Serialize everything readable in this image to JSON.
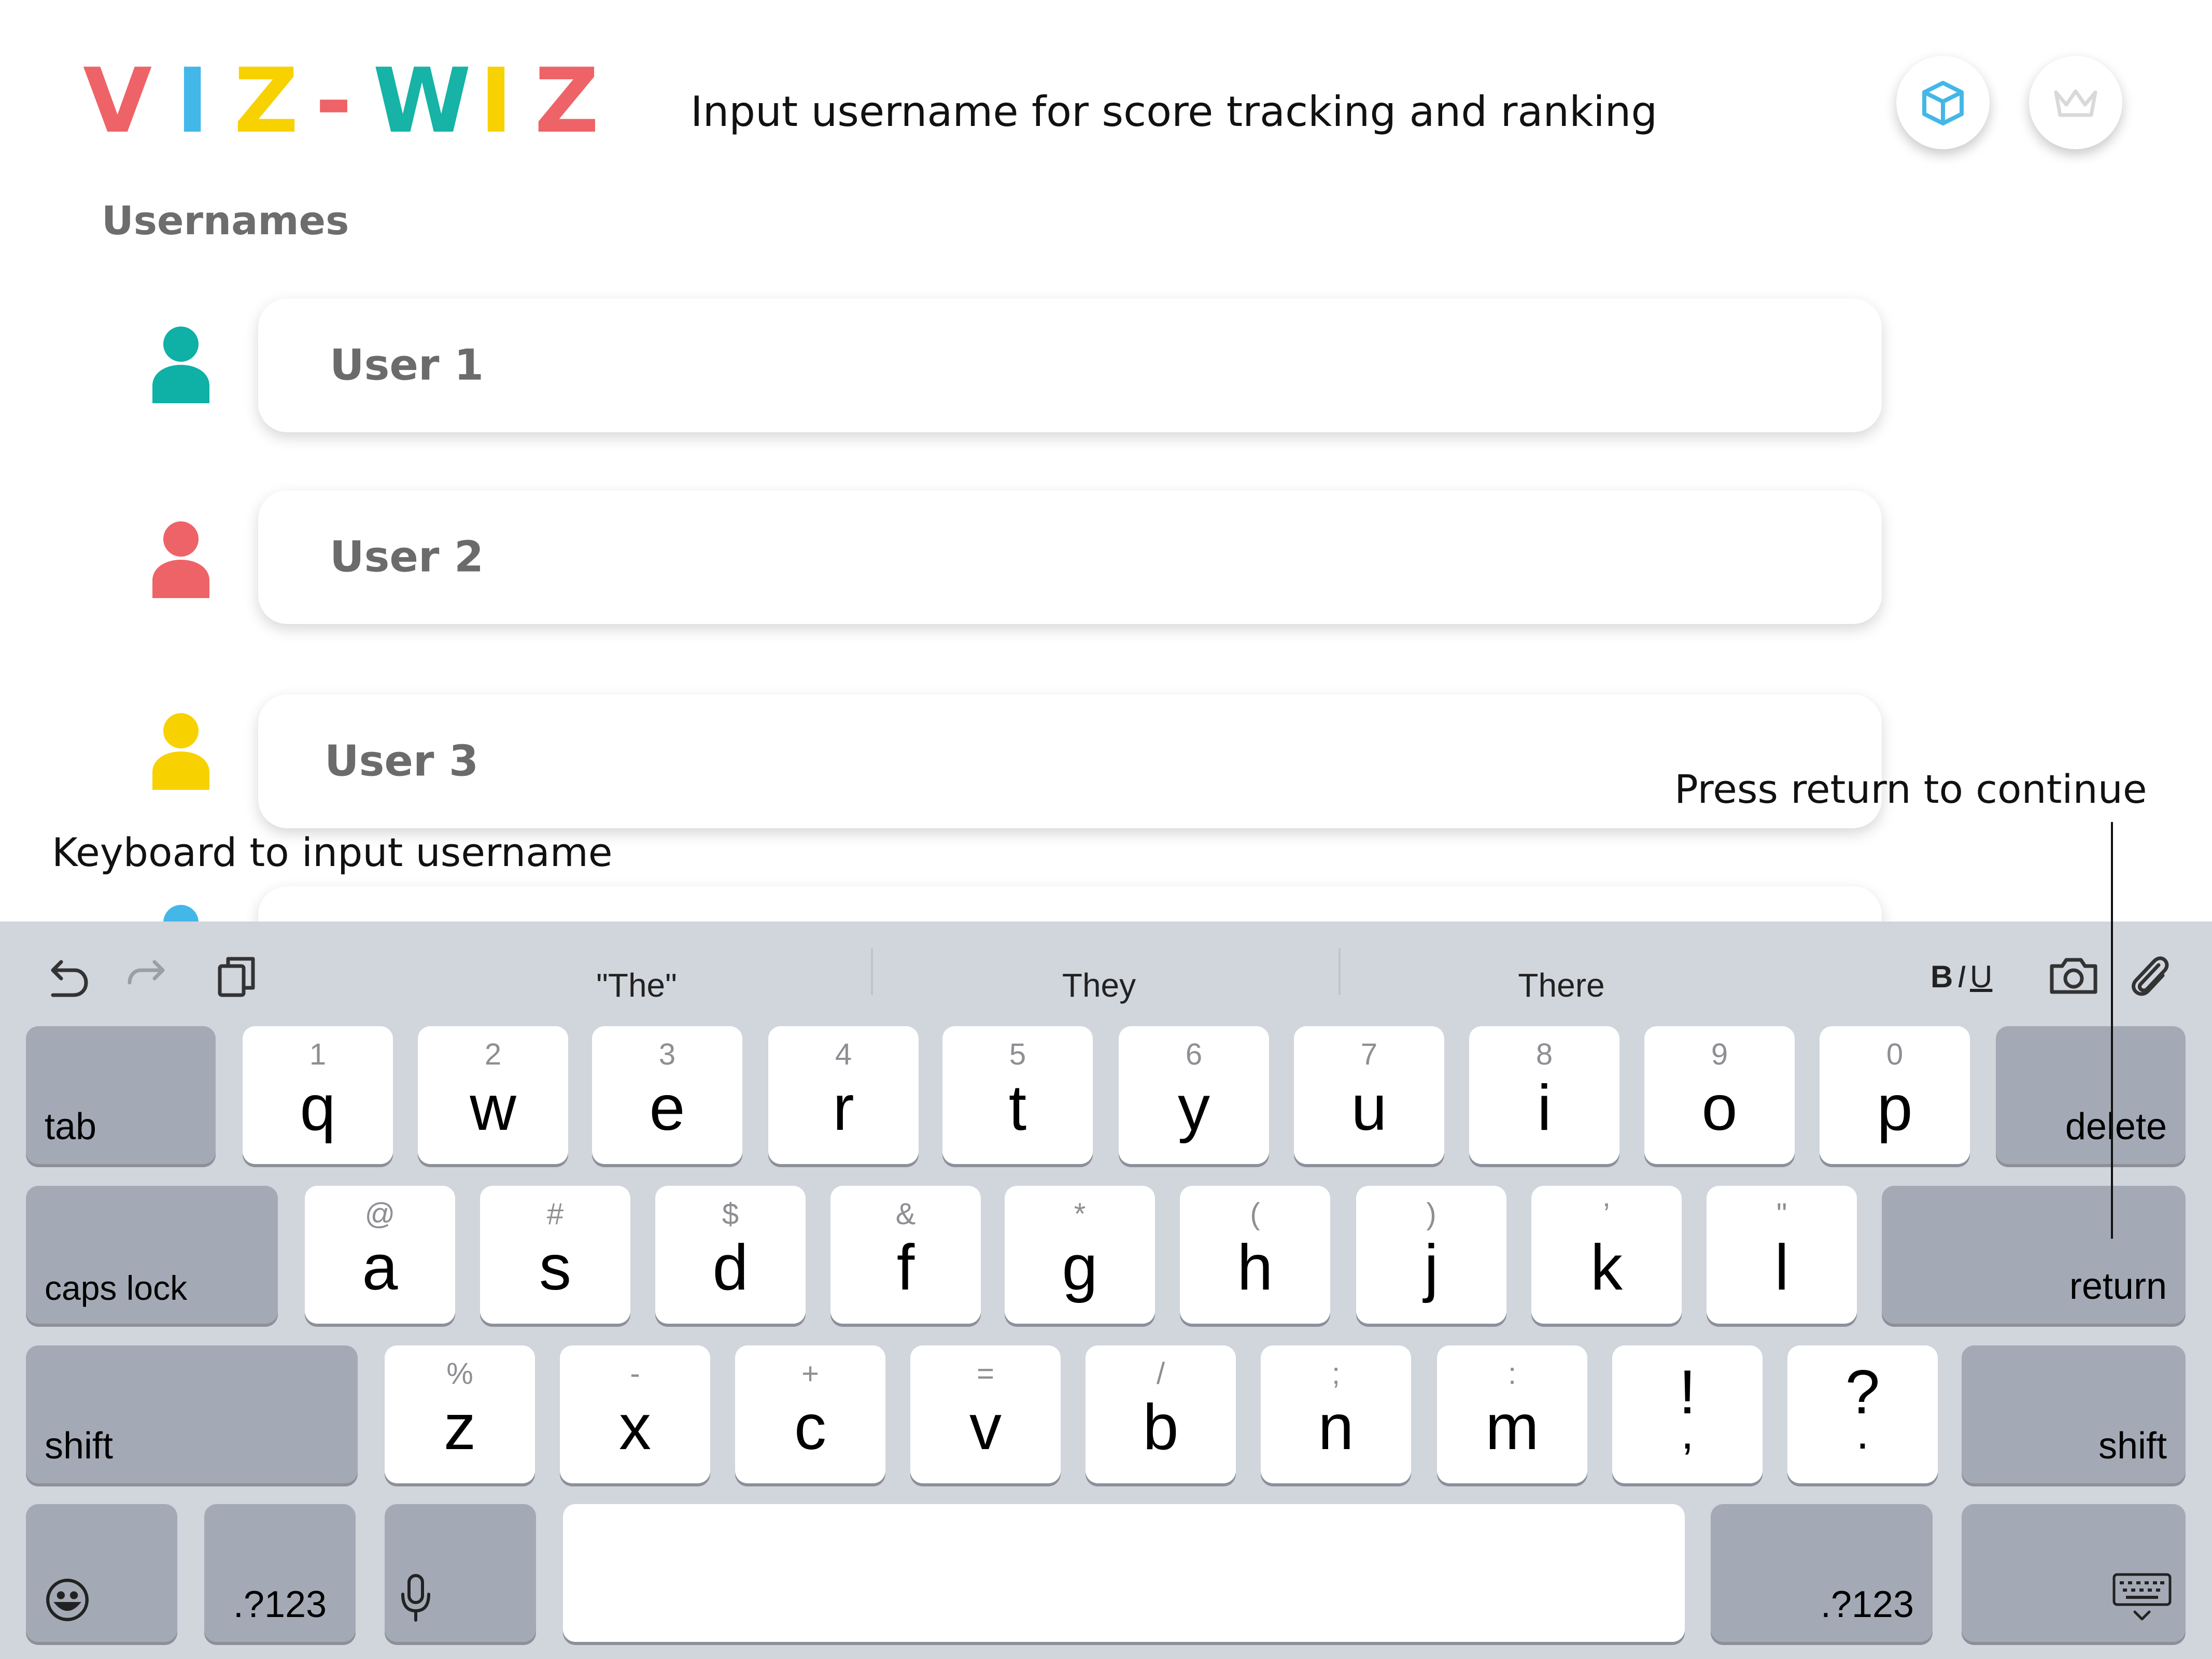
{
  "logo": {
    "letters": [
      {
        "char": "V",
        "color": "#ee6367"
      },
      {
        "char": "I",
        "color": "#43b7e8"
      },
      {
        "char": "Z",
        "color": "#f7d100"
      },
      {
        "char": "-",
        "color": "#ee6367"
      },
      {
        "char": "W",
        "color": "#16b3a6"
      },
      {
        "char": "I",
        "color": "#f7d100"
      },
      {
        "char": "Z",
        "color": "#ee6367"
      }
    ]
  },
  "header": {
    "instruction": "Input username for score tracking  and ranking",
    "buttons": [
      {
        "icon": "cube-icon",
        "color": "#43b7e8"
      },
      {
        "icon": "crown-icon",
        "color": "#d9d9d9"
      }
    ]
  },
  "section_title": "Usernames",
  "users": [
    {
      "placeholder": "User 1",
      "icon_color": "#0fb0a6"
    },
    {
      "placeholder": "User 2",
      "icon_color": "#ee6367"
    },
    {
      "placeholder": "User 3",
      "icon_color": "#f7d100"
    },
    {
      "placeholder": "",
      "icon_color": "#43b7e8"
    }
  ],
  "annotations": {
    "keyboard_label": "Keyboard to input username",
    "return_hint": "Press return to continue"
  },
  "keyboard": {
    "suggestions": [
      "\"The\"",
      "They",
      "There"
    ],
    "format": {
      "bold": "B",
      "italic": "I",
      "underline": "U"
    },
    "rows": [
      [
        {
          "label": "tab",
          "type": "mod"
        },
        {
          "main": "q",
          "sec": "1"
        },
        {
          "main": "w",
          "sec": "2"
        },
        {
          "main": "e",
          "sec": "3"
        },
        {
          "main": "r",
          "sec": "4"
        },
        {
          "main": "t",
          "sec": "5"
        },
        {
          "main": "y",
          "sec": "6"
        },
        {
          "main": "u",
          "sec": "7"
        },
        {
          "main": "i",
          "sec": "8"
        },
        {
          "main": "o",
          "sec": "9"
        },
        {
          "main": "p",
          "sec": "0"
        },
        {
          "label": "delete",
          "type": "mod"
        }
      ],
      [
        {
          "label": "caps lock",
          "type": "mod"
        },
        {
          "main": "a",
          "sec": "@"
        },
        {
          "main": "s",
          "sec": "#"
        },
        {
          "main": "d",
          "sec": "$"
        },
        {
          "main": "f",
          "sec": "&"
        },
        {
          "main": "g",
          "sec": "*"
        },
        {
          "main": "h",
          "sec": "("
        },
        {
          "main": "j",
          "sec": ")"
        },
        {
          "main": "k",
          "sec": "’"
        },
        {
          "main": "l",
          "sec": "\""
        },
        {
          "label": "return",
          "type": "mod"
        }
      ],
      [
        {
          "label": "shift",
          "type": "mod"
        },
        {
          "main": "z",
          "sec": "%"
        },
        {
          "main": "x",
          "sec": "-"
        },
        {
          "main": "c",
          "sec": "+"
        },
        {
          "main": "v",
          "sec": "="
        },
        {
          "main": "b",
          "sec": "/"
        },
        {
          "main": "n",
          "sec": ";"
        },
        {
          "main": "m",
          "sec": ":"
        },
        {
          "top": "!",
          "bottom": ","
        },
        {
          "top": "?",
          "bottom": "."
        },
        {
          "label": "shift",
          "type": "mod"
        }
      ],
      [
        {
          "icon": "emoji-icon",
          "type": "mod"
        },
        {
          "label": ".?123",
          "type": "mod"
        },
        {
          "icon": "microphone-icon",
          "type": "mod"
        },
        {
          "label": "",
          "type": "space"
        },
        {
          "label": ".?123",
          "type": "mod"
        },
        {
          "icon": "keyboard-dismiss-icon",
          "type": "mod"
        }
      ]
    ]
  }
}
